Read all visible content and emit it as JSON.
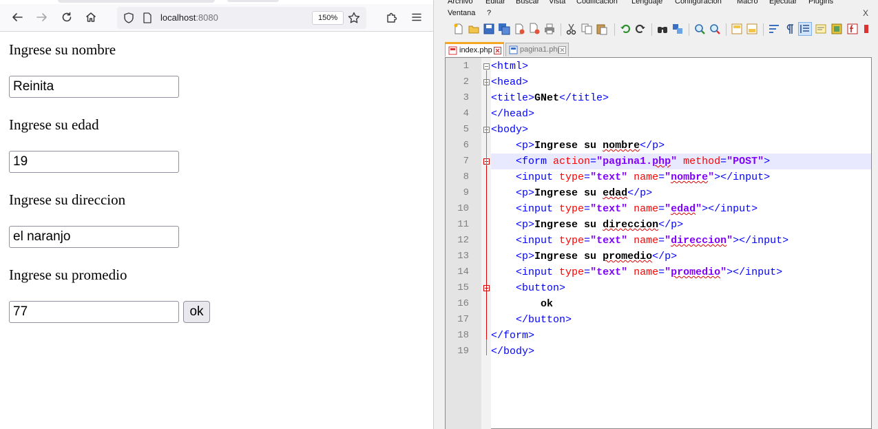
{
  "browser": {
    "url_host": "localhost",
    "url_port": ":8080",
    "zoom": "150%"
  },
  "form": {
    "fields": [
      {
        "label": "Ingrese su nombre",
        "value": "Reinita"
      },
      {
        "label": "Ingrese su edad",
        "value": "19"
      },
      {
        "label": "Ingrese su direccion",
        "value": "el naranjo"
      },
      {
        "label": "Ingrese su promedio",
        "value": "77"
      }
    ],
    "button_label": "ok"
  },
  "editor": {
    "menu_row1": [
      "Archivo",
      "Editar",
      "Buscar",
      "Vista",
      "Codificación",
      "Lenguaje",
      "Configuración",
      "Macro",
      "Ejecutar",
      "Plugins"
    ],
    "menu_row2": [
      "Ventana",
      "?"
    ],
    "close_label": "X",
    "tabs": [
      {
        "name": "index.php",
        "active": true
      },
      {
        "name": "pagina1.php",
        "active": false
      }
    ],
    "line_numbers": [
      "1",
      "2",
      "3",
      "4",
      "5",
      "6",
      "7",
      "8",
      "9",
      "10",
      "11",
      "12",
      "13",
      "14",
      "15",
      "16",
      "17",
      "18",
      "19"
    ],
    "code_lines": [
      [
        {
          "t": "tag",
          "s": "<html>"
        }
      ],
      [
        {
          "t": "tag",
          "s": "<head>"
        }
      ],
      [
        {
          "t": "tag",
          "s": "<title>"
        },
        {
          "t": "txt",
          "s": "GNet"
        },
        {
          "t": "tag",
          "s": "</title>"
        }
      ],
      [
        {
          "t": "tag",
          "s": "</head>"
        }
      ],
      [
        {
          "t": "tag",
          "s": "<body>"
        }
      ],
      [
        {
          "t": "pad",
          "s": "    "
        },
        {
          "t": "tag",
          "s": "<p>"
        },
        {
          "t": "txt",
          "s": "Ingrese su ",
          "sq": false
        },
        {
          "t": "txt",
          "s": "nombre",
          "sq": true
        },
        {
          "t": "tag",
          "s": "</p>"
        }
      ],
      [
        {
          "t": "pad",
          "s": "    "
        },
        {
          "t": "tag",
          "s": "<form "
        },
        {
          "t": "attr",
          "s": "action"
        },
        {
          "t": "tag",
          "s": "="
        },
        {
          "t": "val",
          "s": "\"pagina1."
        },
        {
          "t": "val",
          "s": "php",
          "sq": true
        },
        {
          "t": "val",
          "s": "\""
        },
        {
          "t": "attr",
          "s": " method"
        },
        {
          "t": "tag",
          "s": "="
        },
        {
          "t": "val",
          "s": "\"POST\""
        },
        {
          "t": "tag",
          "s": ">"
        }
      ],
      [
        {
          "t": "pad",
          "s": "    "
        },
        {
          "t": "tag",
          "s": "<input "
        },
        {
          "t": "attr",
          "s": "type"
        },
        {
          "t": "tag",
          "s": "="
        },
        {
          "t": "val",
          "s": "\"text\""
        },
        {
          "t": "attr",
          "s": " name"
        },
        {
          "t": "tag",
          "s": "="
        },
        {
          "t": "val",
          "s": "\""
        },
        {
          "t": "val",
          "s": "nombre",
          "sq": true
        },
        {
          "t": "val",
          "s": "\""
        },
        {
          "t": "tag",
          "s": "></input>"
        }
      ],
      [
        {
          "t": "pad",
          "s": "    "
        },
        {
          "t": "tag",
          "s": "<p>"
        },
        {
          "t": "txt",
          "s": "Ingrese su ",
          "sq": false
        },
        {
          "t": "txt",
          "s": "edad",
          "sq": true
        },
        {
          "t": "tag",
          "s": "</p>"
        }
      ],
      [
        {
          "t": "pad",
          "s": "    "
        },
        {
          "t": "tag",
          "s": "<input "
        },
        {
          "t": "attr",
          "s": "type"
        },
        {
          "t": "tag",
          "s": "="
        },
        {
          "t": "val",
          "s": "\"text\""
        },
        {
          "t": "attr",
          "s": " name"
        },
        {
          "t": "tag",
          "s": "="
        },
        {
          "t": "val",
          "s": "\""
        },
        {
          "t": "val",
          "s": "edad",
          "sq": true
        },
        {
          "t": "val",
          "s": "\""
        },
        {
          "t": "tag",
          "s": "></input>"
        }
      ],
      [
        {
          "t": "pad",
          "s": "    "
        },
        {
          "t": "tag",
          "s": "<p>"
        },
        {
          "t": "txt",
          "s": "Ingrese su ",
          "sq": false
        },
        {
          "t": "txt",
          "s": "direccion",
          "sq": true
        },
        {
          "t": "tag",
          "s": "</p>"
        }
      ],
      [
        {
          "t": "pad",
          "s": "    "
        },
        {
          "t": "tag",
          "s": "<input "
        },
        {
          "t": "attr",
          "s": "type"
        },
        {
          "t": "tag",
          "s": "="
        },
        {
          "t": "val",
          "s": "\"text\""
        },
        {
          "t": "attr",
          "s": " name"
        },
        {
          "t": "tag",
          "s": "="
        },
        {
          "t": "val",
          "s": "\""
        },
        {
          "t": "val",
          "s": "direccion",
          "sq": true
        },
        {
          "t": "val",
          "s": "\""
        },
        {
          "t": "tag",
          "s": "></input>"
        }
      ],
      [
        {
          "t": "pad",
          "s": "    "
        },
        {
          "t": "tag",
          "s": "<p>"
        },
        {
          "t": "txt",
          "s": "Ingrese su ",
          "sq": false
        },
        {
          "t": "txt",
          "s": "promedio",
          "sq": true
        },
        {
          "t": "tag",
          "s": "</p>"
        }
      ],
      [
        {
          "t": "pad",
          "s": "    "
        },
        {
          "t": "tag",
          "s": "<input "
        },
        {
          "t": "attr",
          "s": "type"
        },
        {
          "t": "tag",
          "s": "="
        },
        {
          "t": "val",
          "s": "\"text\""
        },
        {
          "t": "attr",
          "s": " name"
        },
        {
          "t": "tag",
          "s": "="
        },
        {
          "t": "val",
          "s": "\""
        },
        {
          "t": "val",
          "s": "promedio",
          "sq": true
        },
        {
          "t": "val",
          "s": "\""
        },
        {
          "t": "tag",
          "s": "></input>"
        }
      ],
      [
        {
          "t": "pad",
          "s": "    "
        },
        {
          "t": "tag",
          "s": "<button>"
        }
      ],
      [
        {
          "t": "pad",
          "s": "        "
        },
        {
          "t": "txt",
          "s": "ok"
        }
      ],
      [
        {
          "t": "pad",
          "s": "    "
        },
        {
          "t": "tag",
          "s": "</button>"
        }
      ],
      [
        {
          "t": "tag",
          "s": "</form>"
        }
      ],
      [
        {
          "t": "tag",
          "s": "</body>"
        }
      ]
    ],
    "current_line": 7
  },
  "colors": {
    "tag": "#0000ff",
    "attr": "#ff0000",
    "value": "#8000ff",
    "active_tab_accent": "#f5a623",
    "current_line_bg": "#e8e8ff"
  }
}
